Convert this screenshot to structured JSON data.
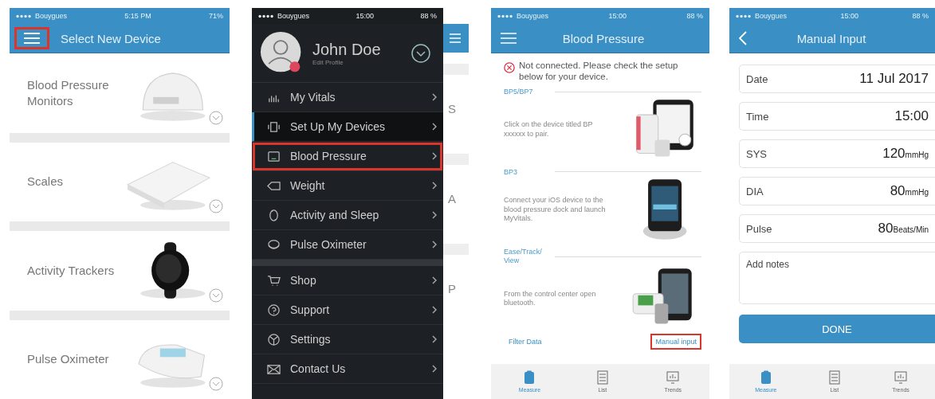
{
  "device_list_screen": {
    "status_bar": {
      "carrier": "Bouygues",
      "time": "5:15 PM",
      "battery": "71%"
    },
    "menu_button": {
      "highlighted": true
    },
    "title": "Select New Device",
    "devices": [
      {
        "name": "Blood Pressure Monitors"
      },
      {
        "name": "Scales"
      },
      {
        "name": "Activity Trackers"
      },
      {
        "name": "Pulse Oximeter"
      }
    ]
  },
  "menu_screen": {
    "status_bar": {
      "carrier": "Bouygues",
      "time": "15:00",
      "battery": "88 %"
    },
    "profile": {
      "name": "John Doe",
      "link": "Edit Profile"
    },
    "sections": [
      [
        {
          "label": "My Vitals",
          "selected": false,
          "highlighted": false
        },
        {
          "label": "Set Up My Devices",
          "selected": true,
          "highlighted": false
        },
        {
          "label": "Blood Pressure",
          "selected": false,
          "highlighted": true
        },
        {
          "label": "Weight",
          "selected": false,
          "highlighted": false
        },
        {
          "label": "Activity and Sleep",
          "selected": false,
          "highlighted": false
        },
        {
          "label": "Pulse Oximeter",
          "selected": false,
          "highlighted": false
        }
      ],
      [
        {
          "label": "Shop",
          "selected": false,
          "highlighted": false
        },
        {
          "label": "Support",
          "selected": false,
          "highlighted": false
        },
        {
          "label": "Settings",
          "selected": false,
          "highlighted": false
        },
        {
          "label": "Contact Us",
          "selected": false,
          "highlighted": false
        }
      ]
    ],
    "behind_letters": [
      "S",
      "A",
      "P"
    ]
  },
  "blood_pressure_screen": {
    "status_bar": {
      "carrier": "Bouygues",
      "time": "15:00",
      "battery": "88 %"
    },
    "title": "Blood Pressure",
    "error": "Not connected. Please check the setup below for your device.",
    "sections": [
      {
        "heading": "BP5/BP7",
        "text": "Click on the device titled BP xxxxxx to pair."
      },
      {
        "heading": "BP3",
        "text": "Connect your iOS device to the blood pressure dock and launch MyVitals."
      },
      {
        "heading": "Ease/Track/ View",
        "text": "From the control center open bluetooth."
      }
    ],
    "filter_link": "Filter Data",
    "manual_link": {
      "label": "Manual input",
      "highlighted": true
    },
    "tabs": [
      {
        "label": "Measure",
        "selected": true
      },
      {
        "label": "List",
        "selected": false
      },
      {
        "label": "Trends",
        "selected": false
      }
    ]
  },
  "manual_input_screen": {
    "status_bar": {
      "carrier": "Bouygues",
      "time": "15:00",
      "battery": "88 %"
    },
    "title": "Manual Input",
    "fields": [
      {
        "label": "Date",
        "value": "11 Jul 2017"
      },
      {
        "label": "Time",
        "value": "15:00"
      },
      {
        "label": "SYS",
        "value": "120",
        "unit": "mmHg"
      },
      {
        "label": "DIA",
        "value": "80",
        "unit": "mmHg"
      },
      {
        "label": "Pulse",
        "value": "80",
        "unit": "Beats/Min"
      }
    ],
    "notes_placeholder": "Add notes",
    "done_button": "DONE",
    "tabs": [
      {
        "label": "Measure",
        "selected": true
      },
      {
        "label": "List",
        "selected": false
      },
      {
        "label": "Trends",
        "selected": false
      }
    ]
  }
}
